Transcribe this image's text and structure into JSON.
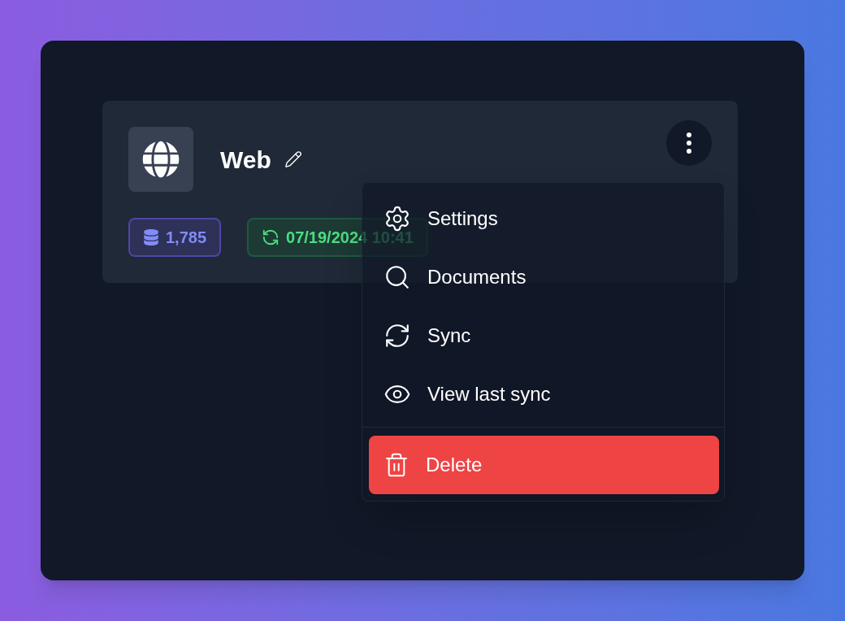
{
  "card": {
    "title": "Web",
    "badges": [
      {
        "kind": "count",
        "text": "1,785"
      },
      {
        "kind": "date",
        "text": "07/19/2024 10:41"
      }
    ]
  },
  "menu": {
    "items": [
      {
        "kind": "item",
        "label": "Settings"
      },
      {
        "kind": "item",
        "label": "Documents"
      },
      {
        "kind": "item",
        "label": "Sync"
      },
      {
        "kind": "item",
        "label": "View last sync"
      },
      {
        "kind": "danger",
        "label": "Delete"
      }
    ]
  }
}
